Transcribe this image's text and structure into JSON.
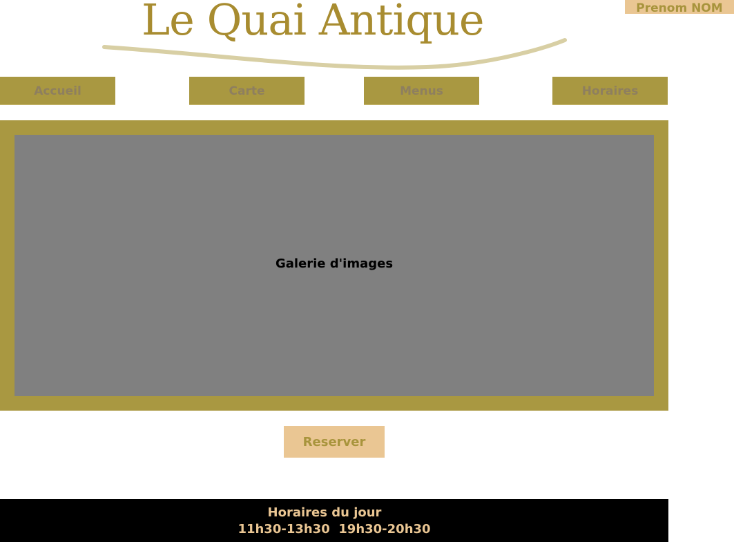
{
  "header": {
    "logo_text": "Le Quai Antique",
    "user_name": "Prenom NOM"
  },
  "nav": {
    "items": [
      {
        "label": "Accueil"
      },
      {
        "label": "Carte"
      },
      {
        "label": "Menus"
      },
      {
        "label": "Horaires"
      }
    ]
  },
  "main": {
    "gallery_label": "Galerie d'images",
    "reserve_label": "Reserver"
  },
  "footer": {
    "title": "Horaires du jour",
    "hours": "11h30-13h30  19h30-20h30"
  },
  "colors": {
    "accent_gold": "#a99841",
    "logo_gold": "#a88c30",
    "peach": "#eac693",
    "gallery_gray": "#808080",
    "footer_bg": "#000000"
  }
}
